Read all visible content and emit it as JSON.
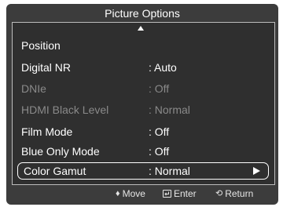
{
  "title": "Picture Options",
  "menu": {
    "items": [
      {
        "label": "Position",
        "value": "",
        "state": "normal"
      },
      {
        "label": "Digital NR",
        "value": ": Auto",
        "state": "normal"
      },
      {
        "label": "DNIe",
        "value": ": Off",
        "state": "disabled"
      },
      {
        "label": "HDMI Black Level",
        "value": ": Normal",
        "state": "disabled"
      },
      {
        "label": "Film Mode",
        "value": ": Off",
        "state": "normal"
      },
      {
        "label": "Blue Only Mode",
        "value": ": Off",
        "state": "normal"
      },
      {
        "label": "Color Gamut",
        "value": ": Normal",
        "state": "selected"
      }
    ]
  },
  "footer": {
    "move_icon": "♦",
    "move_label": "Move",
    "enter_icon": "enter-icon",
    "enter_label": "Enter",
    "return_icon": "⟲",
    "return_label": "Return"
  },
  "colors": {
    "background": "#3c3c3c",
    "panel": "#2f2f2f",
    "text": "#ffffff",
    "disabled_text": "#8a8a8a"
  }
}
